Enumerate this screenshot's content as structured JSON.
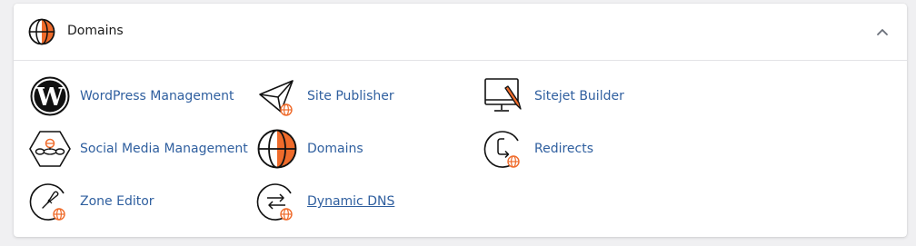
{
  "panel": {
    "title": "Domains",
    "header_icon": "globe-icon",
    "collapse_icon": "chevron-up-icon"
  },
  "items": [
    {
      "label": "WordPress Management",
      "icon": "wordpress-icon"
    },
    {
      "label": "Site Publisher",
      "icon": "paper-plane-icon"
    },
    {
      "label": "Sitejet Builder",
      "icon": "monitor-pencil-icon"
    },
    {
      "label": "Social Media Management",
      "icon": "social-media-icon"
    },
    {
      "label": "Domains",
      "icon": "globe-icon"
    },
    {
      "label": "Redirects",
      "icon": "redirect-icon"
    },
    {
      "label": "Zone Editor",
      "icon": "zone-editor-icon"
    },
    {
      "label": "Dynamic DNS",
      "icon": "dynamic-dns-icon"
    }
  ],
  "colors": {
    "accent": "#ef6b2b",
    "link": "#2f5f9f",
    "icon_stroke": "#111111"
  }
}
